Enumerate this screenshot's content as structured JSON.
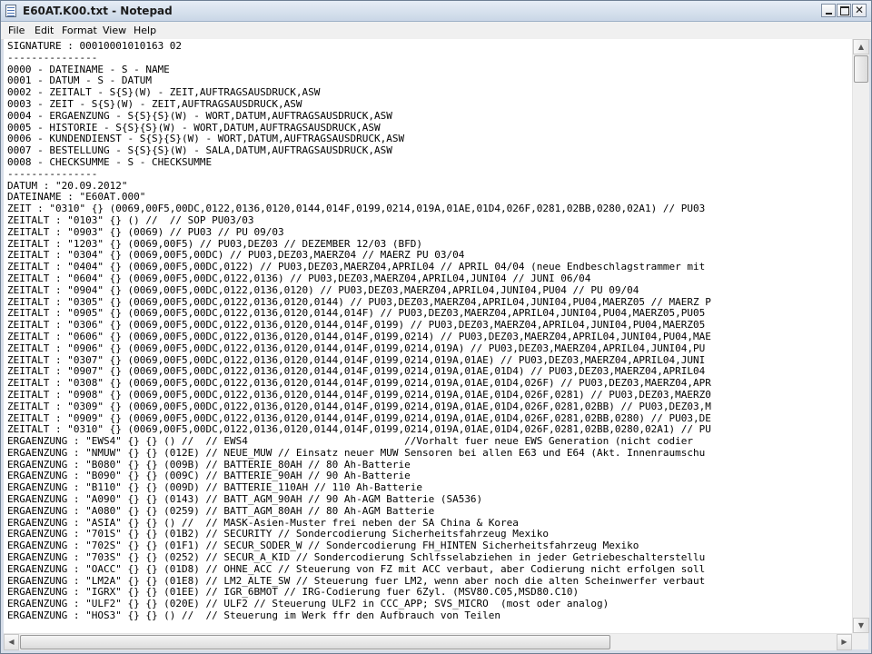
{
  "window": {
    "title": "E60AT.K00.txt - Notepad"
  },
  "menu": [
    "File",
    "Edit",
    "Format",
    "View",
    "Help"
  ],
  "controls": {
    "minimize": "",
    "maximize": "",
    "close": "✕"
  },
  "scrollbar": {
    "up": "▲",
    "down": "▼",
    "left": "◀",
    "right": "▶"
  },
  "document": {
    "lines": [
      "SIGNATURE : 00010001010163 02",
      "---------------",
      "0000 - DATEINAME - S - NAME",
      "0001 - DATUM - S - DATUM",
      "0002 - ZEITALT - S{S}(W) - ZEIT,AUFTRAGSAUSDRUCK,ASW",
      "0003 - ZEIT - S{S}(W) - ZEIT,AUFTRAGSAUSDRUCK,ASW",
      "0004 - ERGAENZUNG - S{S}{S}(W) - WORT,DATUM,AUFTRAGSAUSDRUCK,ASW",
      "0005 - HISTORIE - S{S}{S}(W) - WORT,DATUM,AUFTRAGSAUSDRUCK,ASW",
      "0006 - KUNDENDIENST - S{S}{S}(W) - WORT,DATUM,AUFTRAGSAUSDRUCK,ASW",
      "0007 - BESTELLUNG - S{S}{S}(W) - SALA,DATUM,AUFTRAGSAUSDRUCK,ASW",
      "0008 - CHECKSUMME - S - CHECKSUMME",
      "---------------",
      "DATUM : \"20.09.2012\"",
      "DATEINAME : \"E60AT.000\"",
      "ZEIT : \"0310\" {} (0069,00F5,00DC,0122,0136,0120,0144,014F,0199,0214,019A,01AE,01D4,026F,0281,02BB,0280,02A1) // PU03",
      "ZEITALT : \"0103\" {} () //  // SOP PU03/03",
      "ZEITALT : \"0903\" {} (0069) // PU03 // PU 09/03",
      "ZEITALT : \"1203\" {} (0069,00F5) // PU03,DEZ03 // DEZEMBER 12/03 (BFD)",
      "ZEITALT : \"0304\" {} (0069,00F5,00DC) // PU03,DEZ03,MAERZ04 // MAERZ PU 03/04",
      "ZEITALT : \"0404\" {} (0069,00F5,00DC,0122) // PU03,DEZ03,MAERZ04,APRIL04 // APRIL 04/04 (neue Endbeschlagstrammer mit",
      "ZEITALT : \"0604\" {} (0069,00F5,00DC,0122,0136) // PU03,DEZ03,MAERZ04,APRIL04,JUNI04 // JUNI 06/04",
      "ZEITALT : \"0904\" {} (0069,00F5,00DC,0122,0136,0120) // PU03,DEZ03,MAERZ04,APRIL04,JUNI04,PU04 // PU 09/04",
      "ZEITALT : \"0305\" {} (0069,00F5,00DC,0122,0136,0120,0144) // PU03,DEZ03,MAERZ04,APRIL04,JUNI04,PU04,MAERZ05 // MAERZ P",
      "ZEITALT : \"0905\" {} (0069,00F5,00DC,0122,0136,0120,0144,014F) // PU03,DEZ03,MAERZ04,APRIL04,JUNI04,PU04,MAERZ05,PU05",
      "ZEITALT : \"0306\" {} (0069,00F5,00DC,0122,0136,0120,0144,014F,0199) // PU03,DEZ03,MAERZ04,APRIL04,JUNI04,PU04,MAERZ05",
      "ZEITALT : \"0606\" {} (0069,00F5,00DC,0122,0136,0120,0144,014F,0199,0214) // PU03,DEZ03,MAERZ04,APRIL04,JUNI04,PU04,MAE",
      "ZEITALT : \"0906\" {} (0069,00F5,00DC,0122,0136,0120,0144,014F,0199,0214,019A) // PU03,DEZ03,MAERZ04,APRIL04,JUNI04,PU",
      "ZEITALT : \"0307\" {} (0069,00F5,00DC,0122,0136,0120,0144,014F,0199,0214,019A,01AE) // PU03,DEZ03,MAERZ04,APRIL04,JUNI",
      "ZEITALT : \"0907\" {} (0069,00F5,00DC,0122,0136,0120,0144,014F,0199,0214,019A,01AE,01D4) // PU03,DEZ03,MAERZ04,APRIL04",
      "ZEITALT : \"0308\" {} (0069,00F5,00DC,0122,0136,0120,0144,014F,0199,0214,019A,01AE,01D4,026F) // PU03,DEZ03,MAERZ04,APR",
      "ZEITALT : \"0908\" {} (0069,00F5,00DC,0122,0136,0120,0144,014F,0199,0214,019A,01AE,01D4,026F,0281) // PU03,DEZ03,MAERZ0",
      "ZEITALT : \"0309\" {} (0069,00F5,00DC,0122,0136,0120,0144,014F,0199,0214,019A,01AE,01D4,026F,0281,02BB) // PU03,DEZ03,M",
      "ZEITALT : \"0909\" {} (0069,00F5,00DC,0122,0136,0120,0144,014F,0199,0214,019A,01AE,01D4,026F,0281,02BB,0280) // PU03,DE",
      "ZEITALT : \"0310\" {} (0069,00F5,00DC,0122,0136,0120,0144,014F,0199,0214,019A,01AE,01D4,026F,0281,02BB,0280,02A1) // PU",
      "ERGAENZUNG : \"EWS4\" {} {} () //  // EWS4                          //Vorhalt fuer neue EWS Generation (nicht codier",
      "ERGAENZUNG : \"NMUW\" {} {} (012E) // NEUE_MUW // Einsatz neuer MUW Sensoren bei allen E63 und E64 (Akt. Innenraumschu",
      "ERGAENZUNG : \"B080\" {} {} (009B) // BATTERIE_80AH // 80 Ah-Batterie",
      "ERGAENZUNG : \"B090\" {} {} (009C) // BATTERIE_90AH // 90 Ah-Batterie",
      "ERGAENZUNG : \"B110\" {} {} (009D) // BATTERIE_110AH // 110 Ah-Batterie",
      "ERGAENZUNG : \"A090\" {} {} (0143) // BATT_AGM_90AH // 90 Ah-AGM Batterie (SA536)",
      "ERGAENZUNG : \"A080\" {} {} (0259) // BATT_AGM_80AH // 80 Ah-AGM Batterie",
      "ERGAENZUNG : \"ASIA\" {} {} () //  // MASK-Asien-Muster frei neben der SA China & Korea",
      "ERGAENZUNG : \"701S\" {} {} (01B2) // SECURITY // Sondercodierung Sicherheitsfahrzeug Mexiko",
      "ERGAENZUNG : \"702S\" {} {} (01F1) // SECUR_SODER_W // Sondercodierung FH_HINTEN Sicherheitsfahrzeug Mexiko",
      "ERGAENZUNG : \"703S\" {} {} (0252) // SECUR_A_KID // Sondercodierung Schlfsselabziehen in jeder Getriebeschalterstellu",
      "ERGAENZUNG : \"OACC\" {} {} (01D8) // OHNE_ACC // Steuerung von FZ mit ACC verbaut, aber Codierung nicht erfolgen soll",
      "ERGAENZUNG : \"LM2A\" {} {} (01E8) // LM2_ALTE_SW // Steuerung fuer LM2, wenn aber noch die alten Scheinwerfer verbaut",
      "ERGAENZUNG : \"IGRX\" {} {} (01EE) // IGR_6BMOT // IRG-Codierung fuer 6Zyl. (MSV80.C05,MSD80.C10)",
      "ERGAENZUNG : \"ULF2\" {} {} (020E) // ULF2 // Steuerung ULF2 in CCC_APP; SVS_MICRO  (most oder analog)",
      "ERGAENZUNG : \"HOS3\" {} {} () //  // Steuerung im Werk ffr den Aufbrauch von Teilen"
    ]
  }
}
